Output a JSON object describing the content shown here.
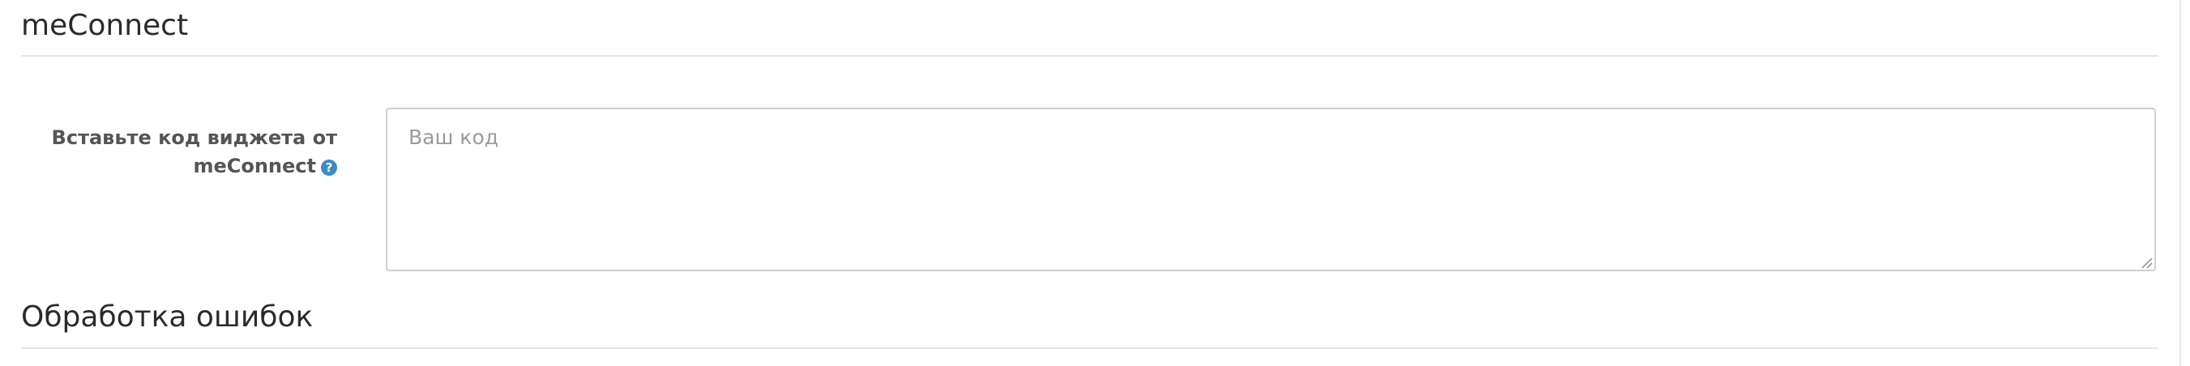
{
  "sections": [
    {
      "title": "meConnect"
    },
    {
      "title": "Обработка ошибок"
    }
  ],
  "widget_field": {
    "label": "Вставьте код виджета от meConnect",
    "help_icon": "?",
    "value": "",
    "placeholder": "Ваш код"
  },
  "colors": {
    "help_icon": "#3a8cc7",
    "rule": "#e6e6e6",
    "field_border": "#cfcfcf"
  }
}
